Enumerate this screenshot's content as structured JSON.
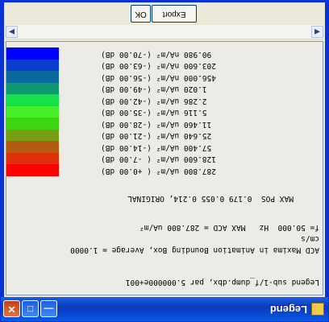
{
  "window": {
    "title": "Legend"
  },
  "legend": {
    "header": "Legend sub-1/f_dump.dbx, par 5.000000e+001",
    "description": "ACD Maxima in Animation Bounding Box, Average = 1.0000",
    "unit": "cm/s",
    "summary": "f= 50.000  Hz   MAX ACD = 287.800 uA/m²",
    "max_pos": "MAX POS  0.179 0.055 0.214, ORIGINAL",
    "rows": [
      {
        "value": "287.800 uA/m² ( +0.00 dB)",
        "color": "#ff0000"
      },
      {
        "value": "128.600 uA/m² ( -7.00 dB)",
        "color": "#e0300a"
      },
      {
        "value": " 57.400 uA/m² (-14.00 dB)",
        "color": "#b15c10"
      },
      {
        "value": " 25.640 uA/m² (-21.00 dB)",
        "color": "#759e12"
      },
      {
        "value": " 11.460 uA/m² (-28.00 dB)",
        "color": "#3bd610"
      },
      {
        "value": "  5.116 uA/m² (-35.00 dB)",
        "color": "#44f02a"
      },
      {
        "value": "  2.286 uA/m² (-42.00 dB)",
        "color": "#15e24b"
      },
      {
        "value": "  1.020 uA/m² (-49.00 dB)",
        "color": "#0a9a6d"
      },
      {
        "value": "456.000 nA/m² (-56.00 dB)",
        "color": "#0a6aa0"
      },
      {
        "value": "203.600 nA/m² (-63.00 dB)",
        "color": "#0a3ecf"
      },
      {
        "value": " 90.980 nA/m² (-70.00 dB)",
        "color": "#0000ff"
      }
    ]
  },
  "buttons": {
    "ok": "OK",
    "export": "Export"
  },
  "titlebar_buttons": {
    "minimize": "—",
    "maximize": "□",
    "close": "✕"
  },
  "scroll": {
    "left": "◀",
    "right": "▶"
  }
}
